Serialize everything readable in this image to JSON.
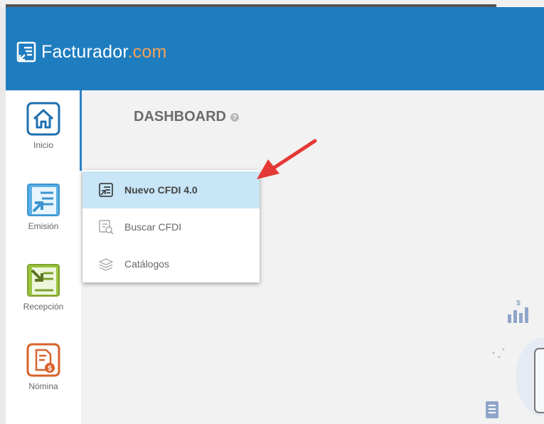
{
  "brand": {
    "name_main": "Facturador",
    "name_domain": ".com"
  },
  "sidebar": {
    "items": [
      {
        "label": "Inicio",
        "icon": "home-icon",
        "color": "#1e6fae"
      },
      {
        "label": "Emisión",
        "icon": "emission-icon",
        "color": "#4aa3df"
      },
      {
        "label": "Recepción",
        "icon": "reception-icon",
        "color": "#8bb33a"
      },
      {
        "label": "Nómina",
        "icon": "payroll-icon",
        "color": "#d9622b"
      }
    ]
  },
  "main": {
    "title": "DASHBOARD",
    "help_glyph": "?"
  },
  "emission_menu": {
    "items": [
      {
        "label": "Nuevo CFDI 4.0",
        "icon": "new-invoice-icon",
        "active": true
      },
      {
        "label": "Buscar CFDI",
        "icon": "search-invoice-icon",
        "active": false
      },
      {
        "label": "Catálogos",
        "icon": "catalogs-icon",
        "active": false
      }
    ]
  },
  "colors": {
    "header": "#1e7dbf",
    "accent_orange": "#f4a259",
    "menu_highlight": "#c8e6f7",
    "arrow": "#e53935"
  }
}
